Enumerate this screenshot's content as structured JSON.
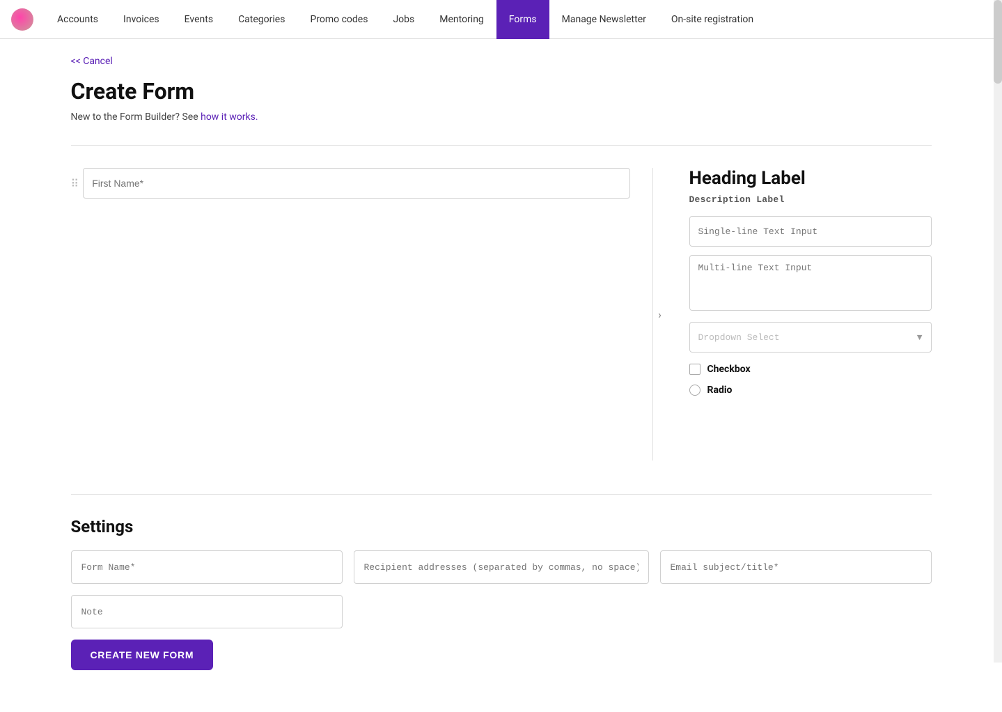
{
  "nav": {
    "items": [
      {
        "label": "Accounts",
        "active": false
      },
      {
        "label": "Invoices",
        "active": false
      },
      {
        "label": "Events",
        "active": false
      },
      {
        "label": "Categories",
        "active": false
      },
      {
        "label": "Promo codes",
        "active": false
      },
      {
        "label": "Jobs",
        "active": false
      },
      {
        "label": "Mentoring",
        "active": false
      },
      {
        "label": "Forms",
        "active": true
      },
      {
        "label": "Manage Newsletter",
        "active": false
      },
      {
        "label": "On-site registration",
        "active": false
      }
    ]
  },
  "cancel_link": "<< Cancel",
  "page_title": "Create Form",
  "subtitle_text": "New to the Form Builder? See ",
  "subtitle_link": "how it works.",
  "form_canvas": {
    "field_placeholder": "First Name*"
  },
  "palette": {
    "heading_label": "Heading Label",
    "description_label": "Description Label",
    "single_line_placeholder": "Single-line Text Input",
    "multi_line_placeholder": "Multi-line Text Input",
    "dropdown_placeholder": "Dropdown Select",
    "checkbox_label": "Checkbox",
    "radio_label": "Radio"
  },
  "settings": {
    "title": "Settings",
    "form_name_placeholder": "Form Name*",
    "recipient_placeholder": "Recipient addresses (separated by commas, no space)*",
    "email_subject_placeholder": "Email subject/title*",
    "note_placeholder": "Note",
    "create_button_label": "CREATE NEW FORM"
  }
}
